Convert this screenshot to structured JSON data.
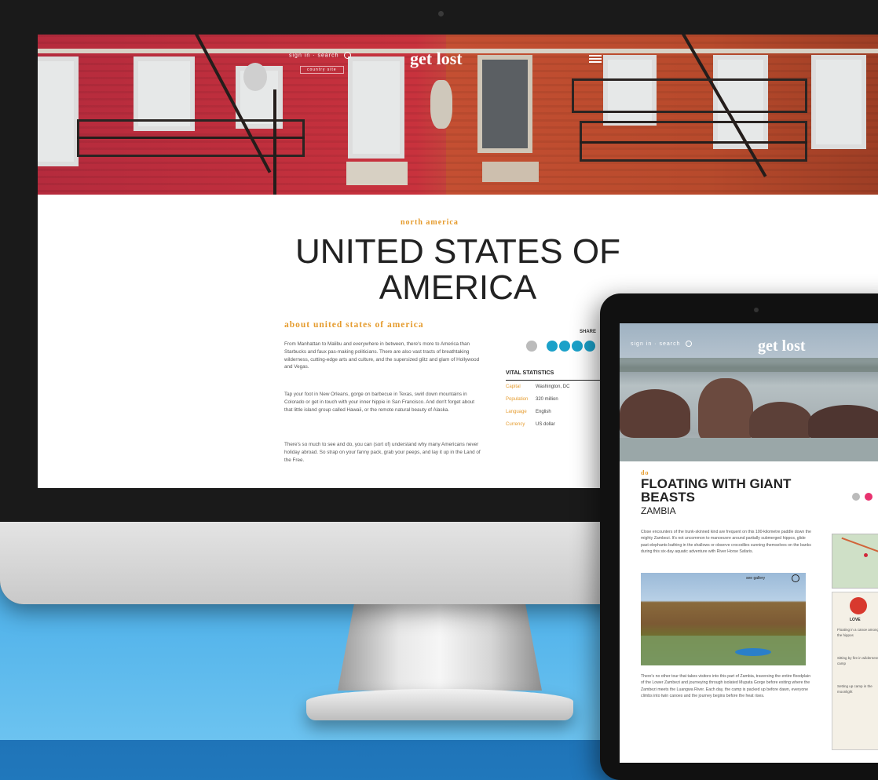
{
  "desktop": {
    "nav": {
      "search_label": "sign in · search",
      "search_sub": "country site",
      "logo": "get lost"
    },
    "kicker": "north america",
    "title_line1": "UNITED STATES OF",
    "title_line2": "AMERICA",
    "about_heading": "about united states of america",
    "paragraphs": [
      "From Manhattan to Malibu and everywhere in between, there's more to America than Starbucks and faux pas-making politicians. There are also vast tracts of breathtaking wilderness, cutting-edge arts and culture, and the supersized glitz and glam of Hollywood and Vegas.",
      "Tap your foot in New Orleans, gorge on barbecue in Texas, swirl down mountains in Colorado or get in touch with your inner hippie in San Francisco. And don't forget about that little island group called Hawaii, or the remote natural beauty of Alaska.",
      "There's so much to see and do, you can (sort of) understand why many Americans never holiday abroad. So strap on your fanny pack, grab your peeps, and lay it up in the Land of the Free."
    ],
    "share_label": "SHARE",
    "vital_heading": "VITAL STATISTICS",
    "vitals": [
      {
        "key": "Capital",
        "value": "Washington, DC"
      },
      {
        "key": "Population",
        "value": "320 million"
      },
      {
        "key": "Language",
        "value": "English"
      },
      {
        "key": "Currency",
        "value": "US dollar"
      }
    ]
  },
  "tablet": {
    "nav_search": "sign in · search",
    "logo": "get lost",
    "kicker": "do",
    "title_line1": "FLOATING WITH GIANT",
    "title_line2": "BEASTS",
    "subtitle": "ZAMBIA",
    "para1": "Close encounters of the trunk-skinned kind are frequent on this 100-kilometre paddle down the mighty Zambezi. It's not uncommon to manoeuvre around partially submerged hippos, glide past elephants bathing in the shallows or observe crocodiles sunning themselves on the banks during this six-day aquatic adventure with River Horse Safaris.",
    "gallery_label": "see gallery",
    "para2": "There's no other tour that takes visitors into this part of Zambia, traversing the entire floodplain of the Lower Zambezi and journeying through isolated Mupata Gorge before exiting where the Zambezi meets the Luangwa River. Each day, the camp is packed up before dawn, everyone climbs into twin canoes and the journey begins before the heat rises.",
    "side_label": "LOVE",
    "side_items": [
      "Floating in a canoe amongst the hippos",
      "Sitting by fire in wilderness camp",
      "Setting up camp in the moonlight"
    ]
  }
}
